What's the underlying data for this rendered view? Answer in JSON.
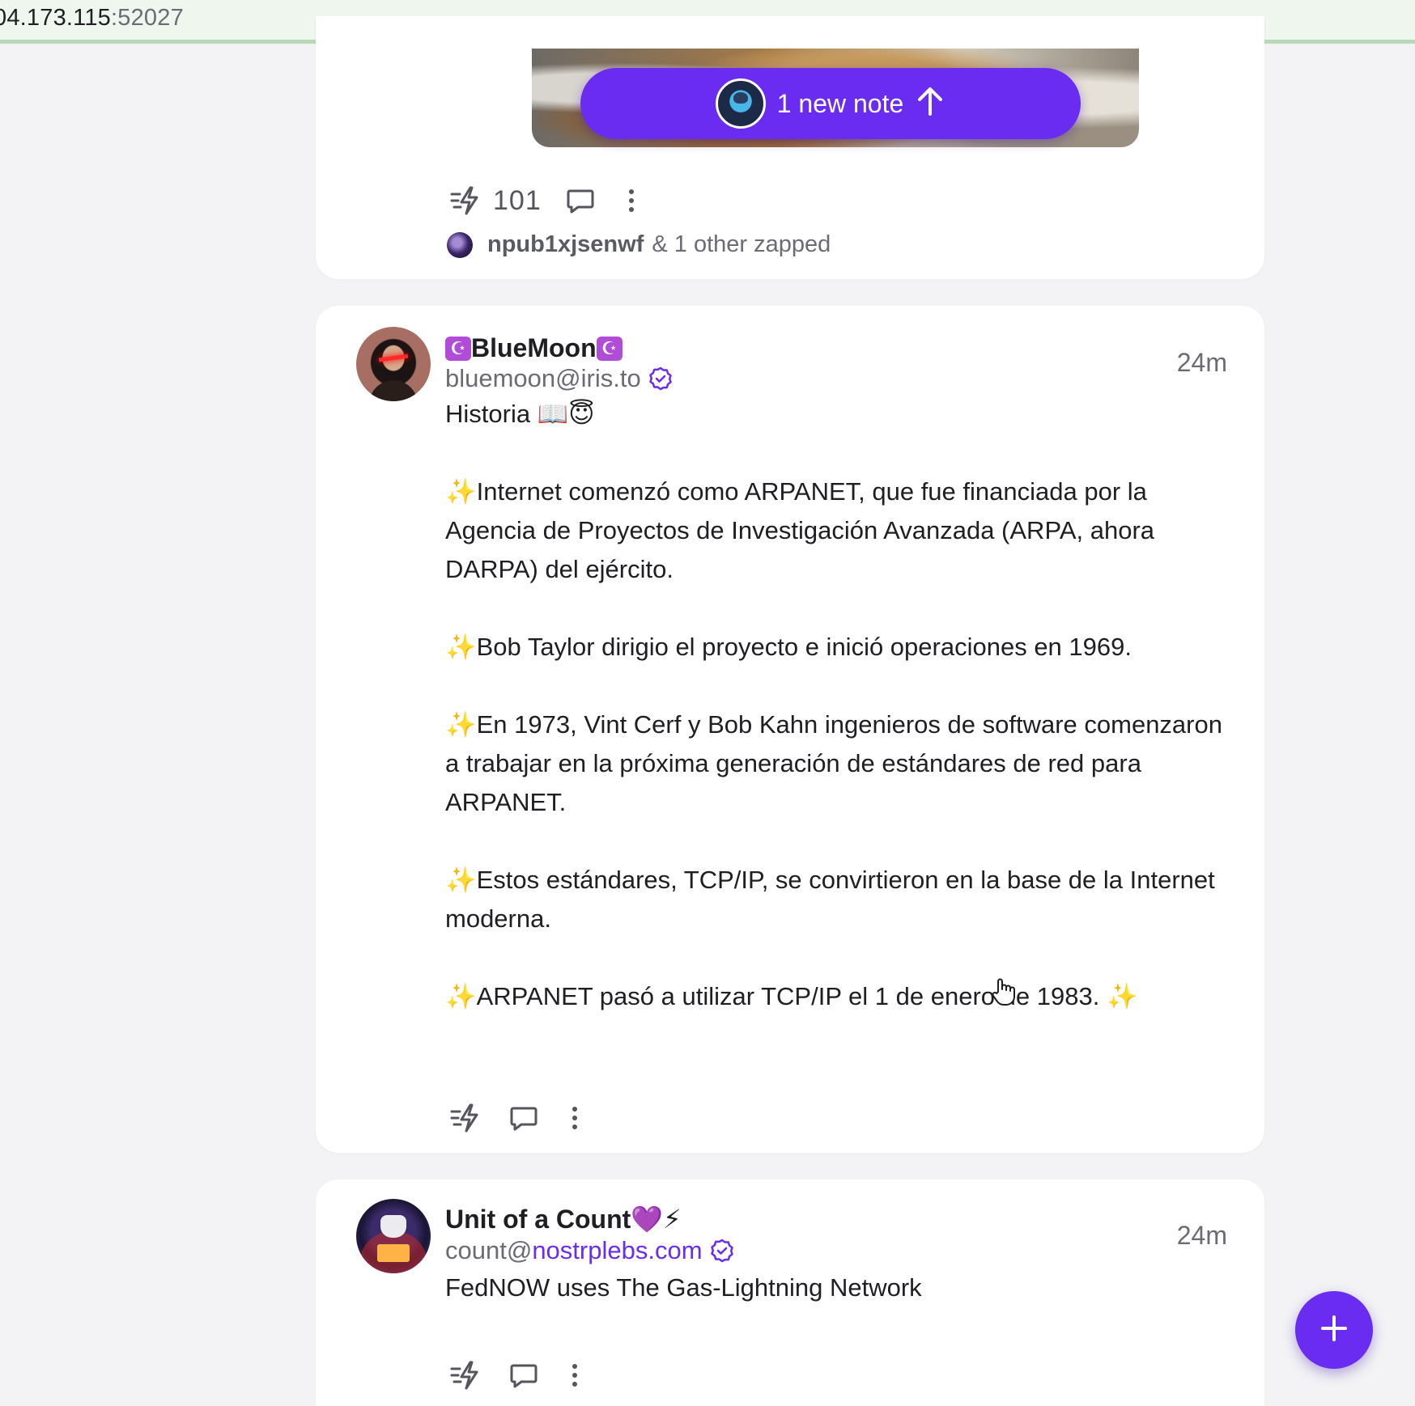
{
  "browser": {
    "url_host": "04.173.115",
    "url_port": ":52027"
  },
  "colors": {
    "accent": "#6a2cf0",
    "muted_text": "#6b6b73",
    "sparkle": "#f2b51d"
  },
  "new_notes_pill": {
    "label": "1 new note",
    "icon": "arrow-up-icon"
  },
  "top_post": {
    "zap_count": "101",
    "zapped_by_name": "npub1xjsenwf",
    "zapped_by_suffix": "& 1 other zapped"
  },
  "posts": [
    {
      "display_name": "BlueMoon",
      "name_prefix_emoji": "☪",
      "name_suffix_emoji": "☪",
      "nip05": "bluemoon@iris.to",
      "time": "24m",
      "title_line": "Historia 📖😇",
      "paragraphs": [
        "Internet comenzó como ARPANET, que fue financiada por la Agencia de Proyectos de Investigación Avanzada (ARPA, ahora DARPA) del ejército.",
        "Bob Taylor dirigio el proyecto e inició operaciones en 1969.",
        "En 1973, Vint Cerf y Bob Kahn ingenieros de software comenzaron a trabajar en la próxima generación de estándares de red para ARPANET.",
        "Estos estándares, TCP/IP, se convirtieron en la base de la Internet moderna.",
        "ARPANET pasó a utilizar TCP/IP el 1 de enero de 1983. "
      ],
      "sparkle": "✨"
    },
    {
      "display_name": "Unit of a Count",
      "name_suffix_emoji": "💜⚡",
      "nip05_user": "count@",
      "nip05_domain": "nostrplebs.com",
      "time": "24m",
      "text": "FedNOW uses The Gas-Lightning Network"
    }
  ],
  "fab": {
    "icon": "plus-icon"
  }
}
